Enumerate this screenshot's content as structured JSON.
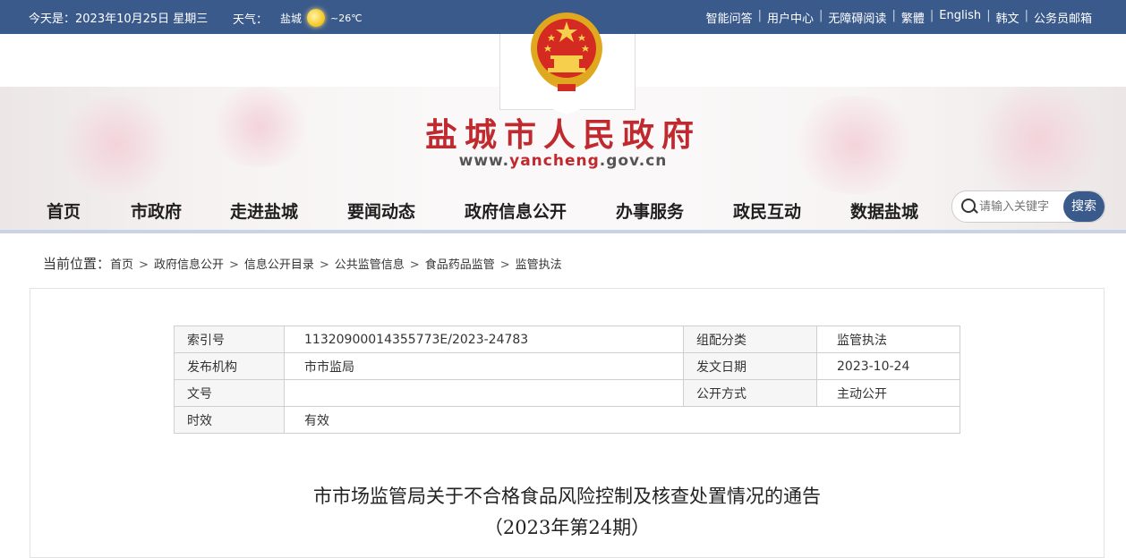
{
  "topbar": {
    "date": "今天是：2023年10月25日 星期三",
    "weather_label": "天气：",
    "city": "盐城",
    "temp": "~26℃",
    "links": [
      "智能问答",
      "用户中心",
      "无障碍阅读",
      "繁體",
      "English",
      "韩文",
      "公务员邮箱"
    ]
  },
  "header": {
    "title": "盐城市人民政府",
    "url_prefix": "www.",
    "url_highlight": "yancheng",
    "url_suffix": ".gov.cn"
  },
  "nav": {
    "items": [
      "首页",
      "市政府",
      "走进盐城",
      "要闻动态",
      "政府信息公开",
      "办事服务",
      "政民互动",
      "数据盐城"
    ],
    "search_placeholder": "请输入关键字",
    "search_button": "搜索"
  },
  "breadcrumb": {
    "lead": "当前位置：",
    "items": [
      "首页",
      "政府信息公开",
      "信息公开目录",
      "公共监管信息",
      "食品药品监管",
      "监管执法"
    ]
  },
  "meta": {
    "rows": [
      [
        "索引号",
        "11320900014355773E/2023-24783",
        "组配分类",
        "监管执法"
      ],
      [
        "发布机构",
        "市市监局",
        "发文日期",
        "2023-10-24"
      ],
      [
        "文号",
        "",
        "公开方式",
        "主动公开"
      ],
      [
        "时效",
        "有效"
      ]
    ]
  },
  "article": {
    "title": "市市场监管局关于不合格食品风险控制及核查处置情况的通告",
    "subtitle": "（2023年第24期）"
  },
  "colors": {
    "topbar": "#3b5a8c",
    "title_red": "#c0292e",
    "search_button": "#3b5a8c"
  }
}
